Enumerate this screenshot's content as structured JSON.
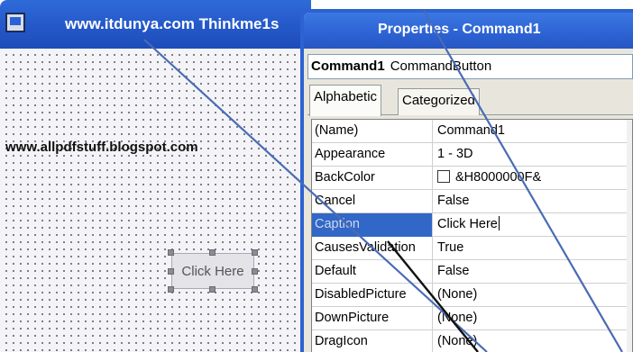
{
  "form_window": {
    "title": "www.itdunya.com  Thinkme1s",
    "watermark": "www.allpdfstuff.blogspot.com",
    "command_button_caption": "Click Here"
  },
  "properties_window": {
    "title": "Properties - Command1",
    "object_name": "Command1",
    "object_type": "CommandButton",
    "tabs": [
      {
        "label": "Alphabetic",
        "active": true
      },
      {
        "label": "Categorized",
        "active": false
      }
    ],
    "rows": [
      {
        "name": "(Name)",
        "value": "Command1"
      },
      {
        "name": "Appearance",
        "value": "1 - 3D"
      },
      {
        "name": "BackColor",
        "value": "&H8000000F&",
        "swatch": "#ffffff"
      },
      {
        "name": "Cancel",
        "value": "False"
      },
      {
        "name": "Caption",
        "value": "Click Here",
        "selected": true
      },
      {
        "name": "CausesValidation",
        "value": "True"
      },
      {
        "name": "Default",
        "value": "False"
      },
      {
        "name": "DisabledPicture",
        "value": "(None)"
      },
      {
        "name": "DownPicture",
        "value": "(None)"
      },
      {
        "name": "DragIcon",
        "value": "(None)"
      }
    ]
  },
  "colors": {
    "titlebar_blue": "#2458c9",
    "selected_row_blue": "#3167c6",
    "annotation_line_blue": "#4a6bb5",
    "annotation_line_black": "#111111"
  }
}
